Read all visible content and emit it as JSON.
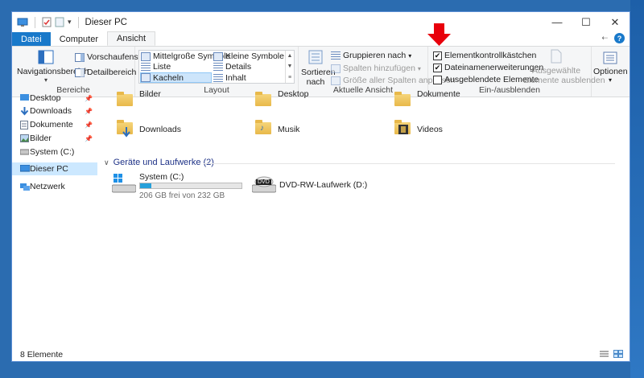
{
  "window": {
    "title": "Dieser PC"
  },
  "tabs": [
    "Datei",
    "Computer",
    "Ansicht"
  ],
  "ribbon": {
    "bereiche": {
      "navigationsbereich": "Navigationsbereich",
      "vorschaufenster": "Vorschaufenster",
      "detailbereich": "Detailbereich",
      "label": "Bereiche"
    },
    "layout": {
      "items": [
        "Mittelgroße Symbole",
        "Kleine Symbole",
        "Liste",
        "Details",
        "Kacheln",
        "Inhalt"
      ],
      "selected": "Kacheln",
      "label": "Layout"
    },
    "aktuelle_ansicht": {
      "sortieren": "Sortieren",
      "nach": "nach",
      "gruppieren": "Gruppieren nach",
      "spalten": "Spalten hinzufügen",
      "groesse": "Größe aller Spalten anpassen",
      "label": "Aktuelle Ansicht"
    },
    "ein_ausblenden": {
      "elementkontroll": {
        "label": "Elementkontrollkästchen",
        "checked": true
      },
      "dateinamenerw": {
        "label": "Dateinamenerweiterungen",
        "checked": true
      },
      "ausgeblendet": {
        "label": "Ausgeblendete Elemente",
        "checked": false
      },
      "ausgewaehlte_1": "Ausgewählte",
      "ausgewaehlte_2": "Elemente ausblenden",
      "label": "Ein-/ausblenden"
    },
    "optionen": "Optionen"
  },
  "nav": {
    "items": [
      {
        "label": "Desktop",
        "pinned": true
      },
      {
        "label": "Downloads",
        "pinned": true
      },
      {
        "label": "Dokumente",
        "pinned": true
      },
      {
        "label": "Bilder",
        "pinned": true
      },
      {
        "label": "System (C:)",
        "pinned": false
      },
      {
        "label": "Dieser PC",
        "pinned": false
      },
      {
        "label": "Netzwerk",
        "pinned": false
      }
    ]
  },
  "folders": [
    "Bilder",
    "Desktop",
    "Dokumente",
    "Downloads",
    "Musik",
    "Videos"
  ],
  "devices": {
    "header": "Geräte und Laufwerke (2)",
    "system": {
      "name": "System (C:)",
      "free": "206 GB frei von 232 GB",
      "used_fraction": 0.11
    },
    "dvd": {
      "name": "DVD-RW-Laufwerk (D:)",
      "badge": "DVD"
    }
  },
  "status": {
    "count": "8 Elemente"
  },
  "colors": {
    "accent": "#1979ca",
    "arrow": "#e8000b",
    "selection": "#cce8ff"
  }
}
